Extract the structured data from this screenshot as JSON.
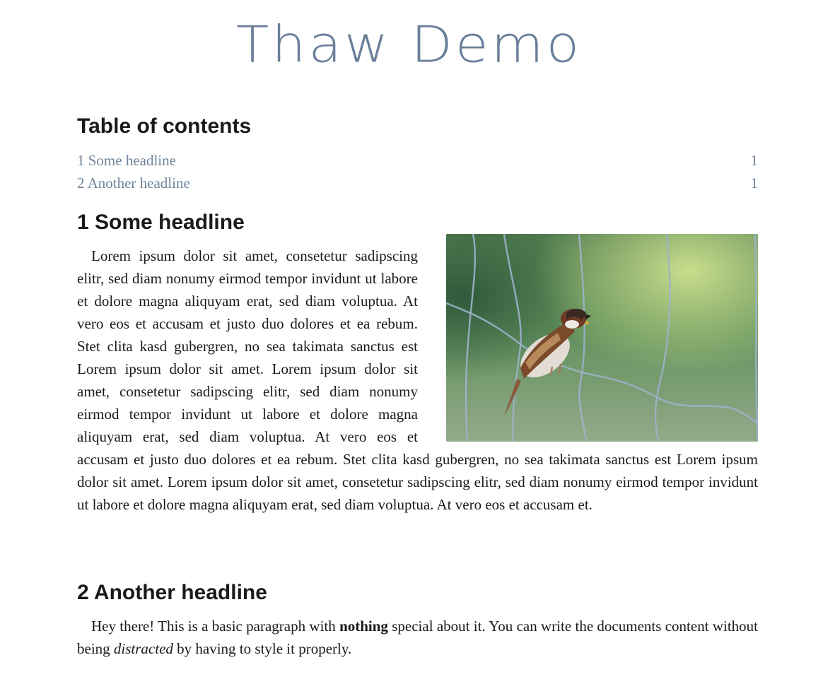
{
  "document": {
    "title": "Thaw Demo"
  },
  "toc": {
    "heading": "Table of contents",
    "entries": [
      {
        "label": "1 Some headline",
        "page": "1"
      },
      {
        "label": "2 Another headline",
        "page": "1"
      }
    ]
  },
  "sections": [
    {
      "heading": "1 Some headline",
      "body": "Lorem ipsum dolor sit amet, consetetur sadipscing elitr, sed diam nonumy eirmod tempor invidunt ut labore et dolore magna aliquyam erat, sed diam voluptua. At vero eos et accusam et justo duo dolores et ea rebum. Stet clita kasd gubergren, no sea takimata sanctus est Lorem ipsum dolor sit amet. Lorem ipsum dolor sit amet, consetetur sadipscing elitr, sed diam nonumy eirmod tempor invidunt ut labore et dolore magna aliquyam erat, sed diam voluptua. At vero eos et accusam et justo duo dolores et ea rebum. Stet clita kasd gubergren, no sea takimata sanctus est Lorem ipsum dolor sit amet. Lorem ipsum dolor sit amet, consetetur sadipscing elitr, sed diam nonumy eirmod tempor invidunt ut labore et dolore magna aliquyam erat, sed diam voluptua. At vero eos et accusam et.",
      "image_icon": "sparrow-on-wire-fence-photo"
    },
    {
      "heading": "2 Another headline",
      "body_before": "Hey there! This is a basic paragraph with ",
      "body_bold": "nothing",
      "body_middle": " special about it. You can write the documents content without being ",
      "body_italic": "distracted",
      "body_after": " by having to style it properly."
    }
  ],
  "colors": {
    "accent": "#6a7f99",
    "link": "#6f8499",
    "text": "#1a1a1a"
  }
}
